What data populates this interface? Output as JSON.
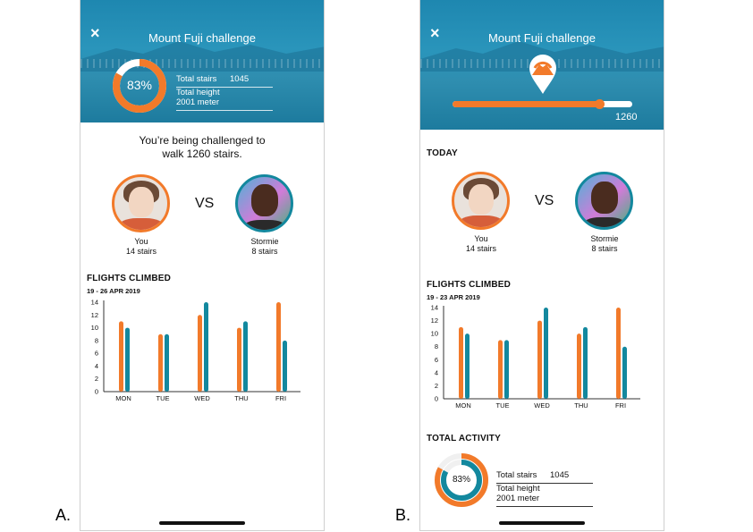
{
  "captions": {
    "a": "A.",
    "b": "B."
  },
  "colors": {
    "orange": "#f27a2a",
    "teal": "#13889e",
    "hero": "#2a95bb"
  },
  "screen_a": {
    "close_icon": "×",
    "title": "Mount Fuji challenge",
    "progress_label": "83%",
    "progress_fraction": 0.83,
    "stats": [
      {
        "label": "Total stairs",
        "value": "1045"
      },
      {
        "label": "Total height",
        "value": "2001 meter"
      }
    ],
    "challenge_line1": "You’re being challenged to",
    "challenge_line2": "walk 1260 stairs.",
    "vs_label": "VS",
    "players": [
      {
        "name": "You",
        "stairs": "14 stairs"
      },
      {
        "name": "Stormie",
        "stairs": "8 stairs"
      }
    ],
    "flights_title": "FLIGHTS CLIMBED",
    "flights_range": "19 - 26 APR 2019"
  },
  "screen_b": {
    "close_icon": "×",
    "title": "Mount Fuji challenge",
    "slider_value": "1260",
    "slider_fraction": 0.82,
    "today_title": "TODAY",
    "vs_label": "VS",
    "players": [
      {
        "name": "You",
        "stairs": "14 stairs"
      },
      {
        "name": "Stormie",
        "stairs": "8 stairs"
      }
    ],
    "flights_title": "FLIGHTS CLIMBED",
    "flights_range": "19 - 23 APR 2019",
    "total_activity_title": "TOTAL ACTIVITY",
    "progress_label": "83%",
    "progress_fraction": 0.83,
    "stats": [
      {
        "label": "Total stairs",
        "value": "1045"
      },
      {
        "label": "Total height",
        "value": "2001 meter"
      }
    ]
  },
  "chart_data": [
    {
      "type": "bar",
      "categories": [
        "MON",
        "TUE",
        "WED",
        "THU",
        "FRI"
      ],
      "series": [
        {
          "values": [
            11,
            9,
            12,
            10,
            14
          ]
        },
        {
          "values": [
            10,
            9,
            14,
            11,
            8
          ]
        }
      ],
      "yticks": [
        "0",
        "2",
        "4",
        "6",
        "8",
        "10",
        "12",
        "14"
      ],
      "ylim": [
        0,
        14
      ]
    },
    {
      "type": "bar",
      "categories": [
        "MON",
        "TUE",
        "WED",
        "THU",
        "FRI"
      ],
      "series": [
        {
          "values": [
            11,
            9,
            12,
            10,
            14
          ]
        },
        {
          "values": [
            10,
            9,
            14,
            11,
            8
          ]
        }
      ],
      "yticks": [
        "0",
        "2",
        "4",
        "6",
        "8",
        "10",
        "12",
        "14"
      ],
      "ylim": [
        0,
        14
      ]
    }
  ]
}
